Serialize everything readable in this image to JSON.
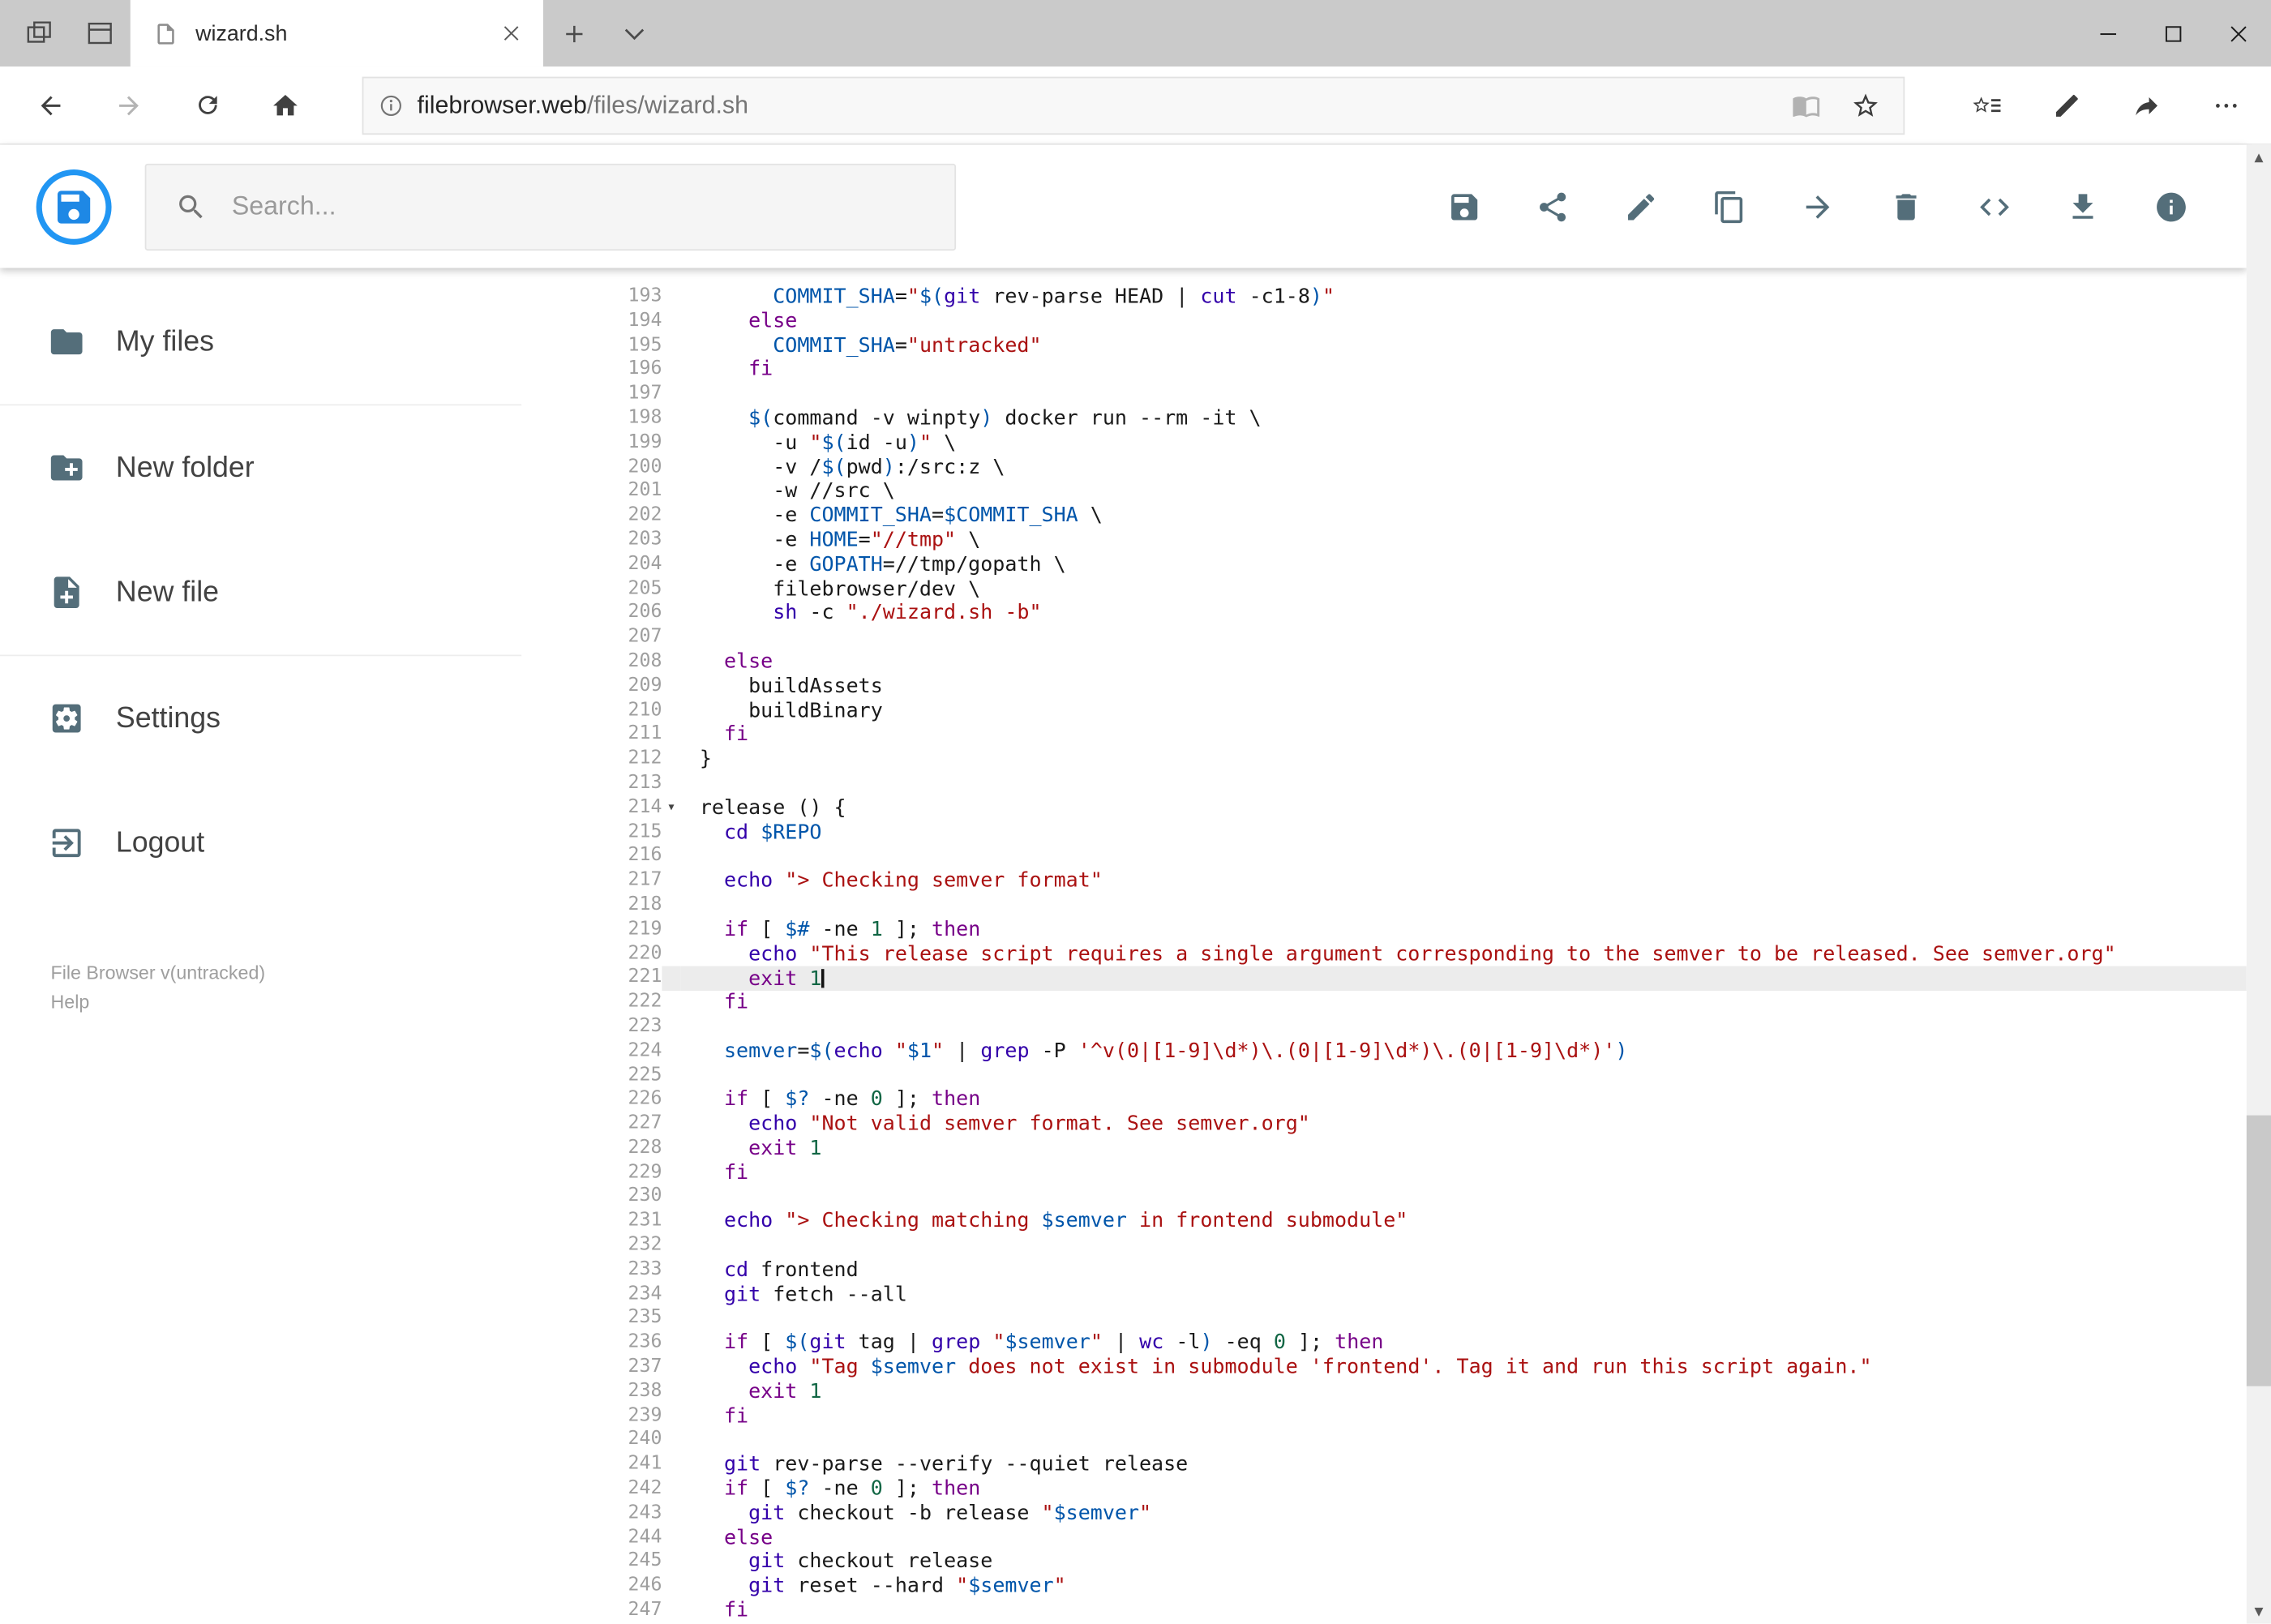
{
  "window": {
    "tab_title": "wizard.sh"
  },
  "browser": {
    "url": {
      "host": "filebrowser.web",
      "path": "/files/wizard.sh"
    }
  },
  "app": {
    "search_placeholder": "Search...",
    "toolbar_icons": [
      "save",
      "share",
      "edit",
      "copy",
      "move",
      "delete",
      "code",
      "download",
      "info"
    ],
    "sidebar": {
      "items": [
        {
          "icon": "folder-icon",
          "label": "My files"
        },
        {
          "icon": "new-folder-icon",
          "label": "New folder"
        },
        {
          "icon": "new-file-icon",
          "label": "New file"
        },
        {
          "icon": "settings-icon",
          "label": "Settings"
        },
        {
          "icon": "logout-icon",
          "label": "Logout"
        }
      ],
      "version": "File Browser v(untracked)",
      "help": "Help"
    }
  },
  "colors": {
    "logo_blue": "#2196f3",
    "header_icon": "#546e7a",
    "active_line_bg": "#ececec",
    "syntax": {
      "keyword": "#770088",
      "builtin": "#3300aa",
      "string": "#aa1111",
      "variable": "#0055aa",
      "number": "#116644"
    }
  },
  "editor": {
    "active_line": 221,
    "cursor_line": 221,
    "fold_marker_line": 214,
    "lines": [
      {
        "n": 193,
        "t": [
          [
            "p",
            "      "
          ],
          [
            "v",
            "COMMIT_SHA"
          ],
          [
            "p",
            "="
          ],
          [
            "s",
            "\""
          ],
          [
            "v",
            "$("
          ],
          [
            "b",
            "git"
          ],
          [
            "p",
            " rev-parse HEAD | "
          ],
          [
            "b",
            "cut"
          ],
          [
            "p",
            " -c1-8"
          ],
          [
            "v",
            ")"
          ],
          [
            "s",
            "\""
          ]
        ]
      },
      {
        "n": 194,
        "t": [
          [
            "p",
            "    "
          ],
          [
            "k",
            "else"
          ]
        ]
      },
      {
        "n": 195,
        "t": [
          [
            "p",
            "      "
          ],
          [
            "v",
            "COMMIT_SHA"
          ],
          [
            "p",
            "="
          ],
          [
            "s",
            "\"untracked\""
          ]
        ]
      },
      {
        "n": 196,
        "t": [
          [
            "p",
            "    "
          ],
          [
            "k",
            "fi"
          ]
        ]
      },
      {
        "n": 197,
        "t": []
      },
      {
        "n": 198,
        "t": [
          [
            "p",
            "    "
          ],
          [
            "v",
            "$("
          ],
          [
            "p",
            "command -v winpty"
          ],
          [
            "v",
            ")"
          ],
          [
            "p",
            " docker run --rm -it \\"
          ]
        ]
      },
      {
        "n": 199,
        "t": [
          [
            "p",
            "      -u "
          ],
          [
            "s",
            "\""
          ],
          [
            "v",
            "$("
          ],
          [
            "p",
            "id -u"
          ],
          [
            "v",
            ")"
          ],
          [
            "s",
            "\""
          ],
          [
            "p",
            " \\"
          ]
        ]
      },
      {
        "n": 200,
        "t": [
          [
            "p",
            "      -v /"
          ],
          [
            "v",
            "$("
          ],
          [
            "p",
            "pwd"
          ],
          [
            "v",
            ")"
          ],
          [
            "p",
            ":/src:z \\"
          ]
        ]
      },
      {
        "n": 201,
        "t": [
          [
            "p",
            "      -w //src \\"
          ]
        ]
      },
      {
        "n": 202,
        "t": [
          [
            "p",
            "      -e "
          ],
          [
            "v",
            "COMMIT_SHA"
          ],
          [
            "p",
            "="
          ],
          [
            "v",
            "$COMMIT_SHA"
          ],
          [
            "p",
            " \\"
          ]
        ]
      },
      {
        "n": 203,
        "t": [
          [
            "p",
            "      -e "
          ],
          [
            "v",
            "HOME"
          ],
          [
            "p",
            "="
          ],
          [
            "s",
            "\"//tmp\""
          ],
          [
            "p",
            " \\"
          ]
        ]
      },
      {
        "n": 204,
        "t": [
          [
            "p",
            "      -e "
          ],
          [
            "v",
            "GOPATH"
          ],
          [
            "p",
            "=//tmp/gopath \\"
          ]
        ]
      },
      {
        "n": 205,
        "t": [
          [
            "p",
            "      filebrowser/dev \\"
          ]
        ]
      },
      {
        "n": 206,
        "t": [
          [
            "p",
            "      "
          ],
          [
            "b",
            "sh"
          ],
          [
            "p",
            " -c "
          ],
          [
            "s",
            "\"./wizard.sh -b\""
          ]
        ]
      },
      {
        "n": 207,
        "t": []
      },
      {
        "n": 208,
        "t": [
          [
            "p",
            "  "
          ],
          [
            "k",
            "else"
          ]
        ]
      },
      {
        "n": 209,
        "t": [
          [
            "p",
            "    buildAssets"
          ]
        ]
      },
      {
        "n": 210,
        "t": [
          [
            "p",
            "    buildBinary"
          ]
        ]
      },
      {
        "n": 211,
        "t": [
          [
            "p",
            "  "
          ],
          [
            "k",
            "fi"
          ]
        ]
      },
      {
        "n": 212,
        "t": [
          [
            "p",
            "}"
          ]
        ]
      },
      {
        "n": 213,
        "t": []
      },
      {
        "n": 214,
        "t": [
          [
            "p",
            "release () {"
          ]
        ]
      },
      {
        "n": 215,
        "t": [
          [
            "p",
            "  "
          ],
          [
            "b",
            "cd"
          ],
          [
            "p",
            " "
          ],
          [
            "v",
            "$REPO"
          ]
        ]
      },
      {
        "n": 216,
        "t": []
      },
      {
        "n": 217,
        "t": [
          [
            "p",
            "  "
          ],
          [
            "b",
            "echo"
          ],
          [
            "p",
            " "
          ],
          [
            "s",
            "\"> Checking semver format\""
          ]
        ]
      },
      {
        "n": 218,
        "t": []
      },
      {
        "n": 219,
        "t": [
          [
            "p",
            "  "
          ],
          [
            "k",
            "if"
          ],
          [
            "p",
            " [ "
          ],
          [
            "v",
            "$#"
          ],
          [
            "p",
            " -ne "
          ],
          [
            "n",
            "1"
          ],
          [
            "p",
            " ]; "
          ],
          [
            "k",
            "then"
          ]
        ]
      },
      {
        "n": 220,
        "t": [
          [
            "p",
            "    "
          ],
          [
            "b",
            "echo"
          ],
          [
            "p",
            " "
          ],
          [
            "s",
            "\"This release script requires a single argument corresponding to the semver to be released. See semver.org\""
          ]
        ]
      },
      {
        "n": 221,
        "t": [
          [
            "p",
            "    "
          ],
          [
            "k",
            "exit"
          ],
          [
            "p",
            " "
          ],
          [
            "n",
            "1"
          ]
        ]
      },
      {
        "n": 222,
        "t": [
          [
            "p",
            "  "
          ],
          [
            "k",
            "fi"
          ]
        ]
      },
      {
        "n": 223,
        "t": []
      },
      {
        "n": 224,
        "t": [
          [
            "p",
            "  "
          ],
          [
            "v",
            "semver"
          ],
          [
            "p",
            "="
          ],
          [
            "v",
            "$("
          ],
          [
            "b",
            "echo"
          ],
          [
            "p",
            " "
          ],
          [
            "s",
            "\""
          ],
          [
            "v",
            "$1"
          ],
          [
            "s",
            "\""
          ],
          [
            "p",
            " | "
          ],
          [
            "b",
            "grep"
          ],
          [
            "p",
            " -P "
          ],
          [
            "s",
            "'^v(0|[1-9]\\d*)\\.(0|[1-9]\\d*)\\.(0|[1-9]\\d*)'"
          ],
          [
            "v",
            ")"
          ]
        ]
      },
      {
        "n": 225,
        "t": []
      },
      {
        "n": 226,
        "t": [
          [
            "p",
            "  "
          ],
          [
            "k",
            "if"
          ],
          [
            "p",
            " [ "
          ],
          [
            "v",
            "$?"
          ],
          [
            "p",
            " -ne "
          ],
          [
            "n",
            "0"
          ],
          [
            "p",
            " ]; "
          ],
          [
            "k",
            "then"
          ]
        ]
      },
      {
        "n": 227,
        "t": [
          [
            "p",
            "    "
          ],
          [
            "b",
            "echo"
          ],
          [
            "p",
            " "
          ],
          [
            "s",
            "\"Not valid semver format. See semver.org\""
          ]
        ]
      },
      {
        "n": 228,
        "t": [
          [
            "p",
            "    "
          ],
          [
            "k",
            "exit"
          ],
          [
            "p",
            " "
          ],
          [
            "n",
            "1"
          ]
        ]
      },
      {
        "n": 229,
        "t": [
          [
            "p",
            "  "
          ],
          [
            "k",
            "fi"
          ]
        ]
      },
      {
        "n": 230,
        "t": []
      },
      {
        "n": 231,
        "t": [
          [
            "p",
            "  "
          ],
          [
            "b",
            "echo"
          ],
          [
            "p",
            " "
          ],
          [
            "s",
            "\"> Checking matching "
          ],
          [
            "v",
            "$semver"
          ],
          [
            "s",
            " in frontend submodule\""
          ]
        ]
      },
      {
        "n": 232,
        "t": []
      },
      {
        "n": 233,
        "t": [
          [
            "p",
            "  "
          ],
          [
            "b",
            "cd"
          ],
          [
            "p",
            " frontend"
          ]
        ]
      },
      {
        "n": 234,
        "t": [
          [
            "p",
            "  "
          ],
          [
            "b",
            "git"
          ],
          [
            "p",
            " fetch --all"
          ]
        ]
      },
      {
        "n": 235,
        "t": []
      },
      {
        "n": 236,
        "t": [
          [
            "p",
            "  "
          ],
          [
            "k",
            "if"
          ],
          [
            "p",
            " [ "
          ],
          [
            "v",
            "$("
          ],
          [
            "b",
            "git"
          ],
          [
            "p",
            " tag | "
          ],
          [
            "b",
            "grep"
          ],
          [
            "p",
            " "
          ],
          [
            "s",
            "\""
          ],
          [
            "v",
            "$semver"
          ],
          [
            "s",
            "\""
          ],
          [
            "p",
            " | "
          ],
          [
            "b",
            "wc"
          ],
          [
            "p",
            " -l"
          ],
          [
            "v",
            ")"
          ],
          [
            "p",
            " -eq "
          ],
          [
            "n",
            "0"
          ],
          [
            "p",
            " ]; "
          ],
          [
            "k",
            "then"
          ]
        ]
      },
      {
        "n": 237,
        "t": [
          [
            "p",
            "    "
          ],
          [
            "b",
            "echo"
          ],
          [
            "p",
            " "
          ],
          [
            "s",
            "\"Tag "
          ],
          [
            "v",
            "$semver"
          ],
          [
            "s",
            " does not exist in submodule 'frontend'. Tag it and run this script again.\""
          ]
        ]
      },
      {
        "n": 238,
        "t": [
          [
            "p",
            "    "
          ],
          [
            "k",
            "exit"
          ],
          [
            "p",
            " "
          ],
          [
            "n",
            "1"
          ]
        ]
      },
      {
        "n": 239,
        "t": [
          [
            "p",
            "  "
          ],
          [
            "k",
            "fi"
          ]
        ]
      },
      {
        "n": 240,
        "t": []
      },
      {
        "n": 241,
        "t": [
          [
            "p",
            "  "
          ],
          [
            "b",
            "git"
          ],
          [
            "p",
            " rev-parse --verify --quiet release"
          ]
        ]
      },
      {
        "n": 242,
        "t": [
          [
            "p",
            "  "
          ],
          [
            "k",
            "if"
          ],
          [
            "p",
            " [ "
          ],
          [
            "v",
            "$?"
          ],
          [
            "p",
            " -ne "
          ],
          [
            "n",
            "0"
          ],
          [
            "p",
            " ]; "
          ],
          [
            "k",
            "then"
          ]
        ]
      },
      {
        "n": 243,
        "t": [
          [
            "p",
            "    "
          ],
          [
            "b",
            "git"
          ],
          [
            "p",
            " checkout -b release "
          ],
          [
            "s",
            "\""
          ],
          [
            "v",
            "$semver"
          ],
          [
            "s",
            "\""
          ]
        ]
      },
      {
        "n": 244,
        "t": [
          [
            "p",
            "  "
          ],
          [
            "k",
            "else"
          ]
        ]
      },
      {
        "n": 245,
        "t": [
          [
            "p",
            "    "
          ],
          [
            "b",
            "git"
          ],
          [
            "p",
            " checkout release"
          ]
        ]
      },
      {
        "n": 246,
        "t": [
          [
            "p",
            "    "
          ],
          [
            "b",
            "git"
          ],
          [
            "p",
            " reset --hard "
          ],
          [
            "s",
            "\""
          ],
          [
            "v",
            "$semver"
          ],
          [
            "s",
            "\""
          ]
        ]
      },
      {
        "n": 247,
        "t": [
          [
            "p",
            "  "
          ],
          [
            "k",
            "fi"
          ]
        ]
      }
    ]
  }
}
